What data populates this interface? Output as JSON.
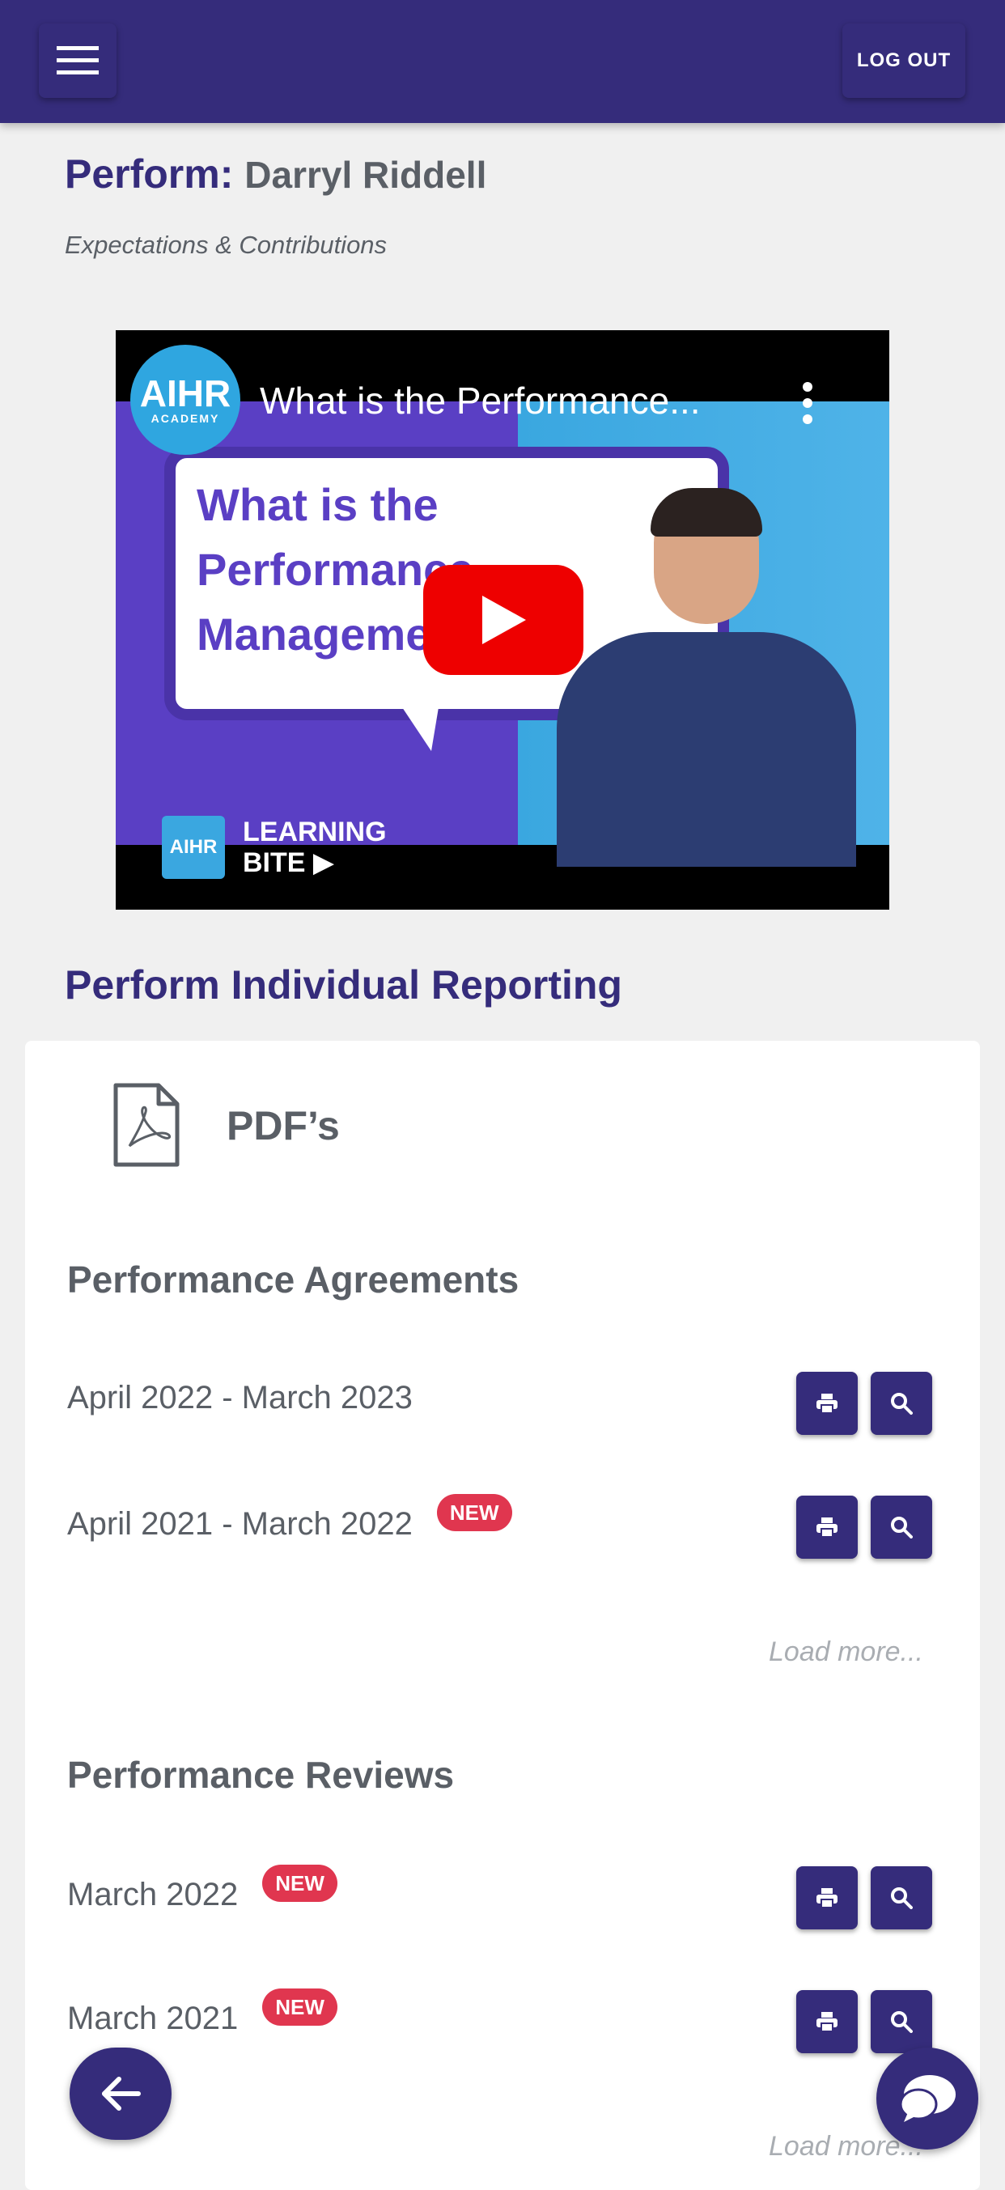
{
  "header": {
    "logout_label": "LOG OUT"
  },
  "page": {
    "title_prefix": "Perform:",
    "title_name": "Darryl Riddell",
    "subtitle": "Expectations & Contributions"
  },
  "video": {
    "title": "What is the Performance...",
    "channel_logo_text": "AIHR",
    "channel_logo_subtext": "ACADEMY",
    "bubble_line1": "What is the",
    "bubble_line2": "Performance",
    "bubble_line3": "Manageme        e?",
    "badge_logo_text": "AIHR",
    "learning_line1": "LEARNING",
    "learning_line2": "BITE ▶"
  },
  "reporting": {
    "section_title": "Perform Individual Reporting",
    "pdf_heading": "PDF’s",
    "new_badge": "NEW",
    "load_more": "Load more...",
    "agreements": {
      "title": "Performance Agreements",
      "rows": [
        {
          "label": "April 2022 - March 2023",
          "is_new": false
        },
        {
          "label": "April 2021 - March 2022",
          "is_new": true
        }
      ]
    },
    "reviews": {
      "title": "Performance Reviews",
      "rows": [
        {
          "label": "March 2022",
          "is_new": true
        },
        {
          "label": "March 2021",
          "is_new": true
        }
      ]
    }
  },
  "colors": {
    "primary": "#352c7b",
    "badge": "#e0364f",
    "background": "#f0f0f0",
    "text": "#5a5f66",
    "muted": "#a9adb2"
  },
  "icons": {
    "menu": "hamburger-icon",
    "print": "print-icon",
    "view": "search-icon",
    "back": "arrow-left-icon",
    "chat": "chat-bubble-icon",
    "pdf": "pdf-file-icon"
  }
}
